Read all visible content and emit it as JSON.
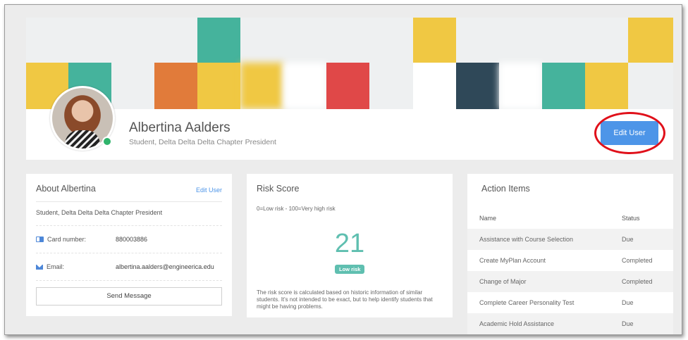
{
  "profile": {
    "name": "Albertina Aalders",
    "subtitle": "Student, Delta Delta Delta Chapter President",
    "edit_button": "Edit User",
    "online": true
  },
  "about": {
    "title": "About Albertina",
    "edit_link": "Edit User",
    "role": "Student, Delta Delta Delta Chapter President",
    "card_label": "Card number:",
    "card_value": "880003886",
    "email_label": "Email:",
    "email_value": "albertina.aalders@engineerica.edu",
    "send_button": "Send Message"
  },
  "risk": {
    "title": "Risk Score",
    "scale": "0=Low risk - 100=Very high risk",
    "score": "21",
    "badge": "Low risk",
    "note": "The risk score is calculated based on historic information of similar students. It's not intended to be exact, but to help identify students that might be having problems."
  },
  "actions": {
    "title": "Action Items",
    "columns": [
      "Name",
      "Status"
    ],
    "rows": [
      {
        "name": "Assistance with Course Selection",
        "status": "Due"
      },
      {
        "name": "Create MyPlan Account",
        "status": "Completed"
      },
      {
        "name": "Change of Major",
        "status": "Completed"
      },
      {
        "name": "Complete Career Personality Test",
        "status": "Due"
      },
      {
        "name": "Academic Hold Assistance",
        "status": "Due"
      }
    ]
  },
  "colors": {
    "accent": "#4d95e8",
    "risk_low": "#5fbfb0",
    "online": "#2fb36b",
    "highlight": "#e0101a",
    "banner": [
      "#f0c843",
      "#45b39c",
      "#e17b3a",
      "#e04848",
      "#2f4858",
      "#ffffff"
    ]
  }
}
